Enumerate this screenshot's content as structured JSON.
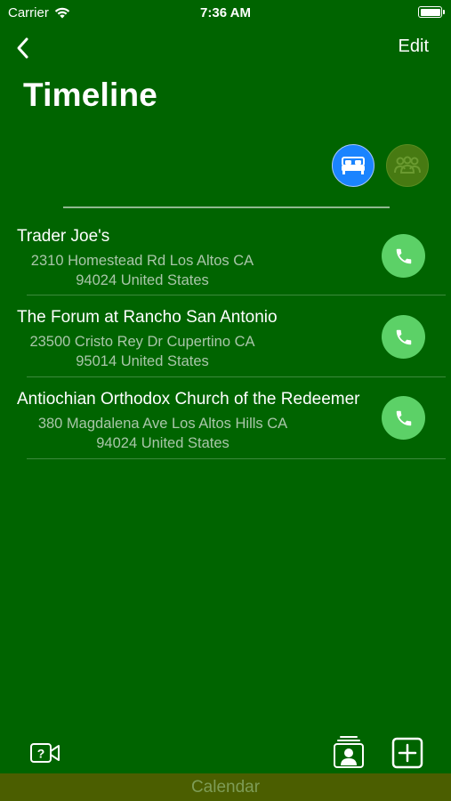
{
  "status_bar": {
    "carrier": "Carrier",
    "time": "7:36 AM",
    "battery_level": 1.0
  },
  "nav": {
    "back_icon": "chevron-left-icon",
    "edit_label": "Edit"
  },
  "title": "Timeline",
  "filters": [
    {
      "name": "hotels",
      "icon": "bed-icon",
      "active": true,
      "color": "#1a84ff"
    },
    {
      "name": "people",
      "icon": "group-icon",
      "active": false,
      "color": "#477a12"
    }
  ],
  "places": [
    {
      "name": "Trader Joe's",
      "address_line1": "2310 Homestead Rd Los Altos CA",
      "address_line2": "94024 United States"
    },
    {
      "name": "The Forum at Rancho San Antonio",
      "address_line1": "23500 Cristo Rey Dr Cupertino CA",
      "address_line2": "95014 United States"
    },
    {
      "name": "Antiochian Orthodox Church of the Redeemer",
      "address_line1": "380 Magdalena Ave Los Altos Hills CA",
      "address_line2": "94024 United States"
    }
  ],
  "toolbar": {
    "video_help_icon": "video-help-icon",
    "contacts_icon": "contacts-icon",
    "add_icon": "add-square-icon"
  },
  "bottom_tab": {
    "label": "Calendar"
  },
  "colors": {
    "background": "#006400",
    "call_button": "#5cd167",
    "address_text": "#a9c6a9",
    "calendar_bar": "#4b5e00"
  }
}
